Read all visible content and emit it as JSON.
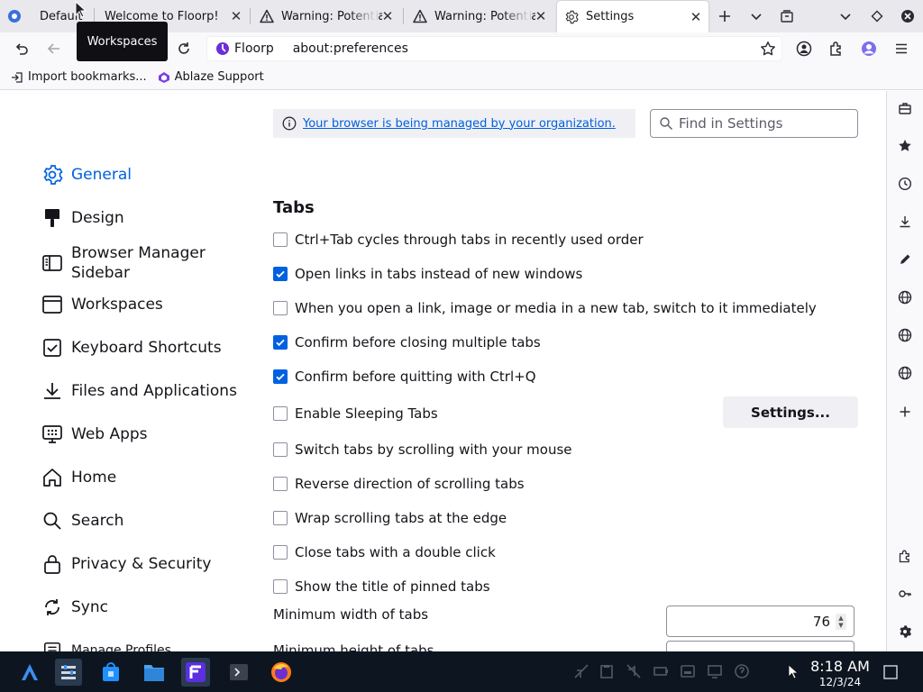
{
  "tabs": [
    {
      "title": "Default",
      "icon": "floorp-workspace-icon"
    },
    {
      "title": "Welcome to Floorp!",
      "icon": "none"
    },
    {
      "title": "Warning: Potential Security Risk",
      "icon": "warning-icon"
    },
    {
      "title": "Warning: Potential Security Risk",
      "icon": "warning-icon"
    },
    {
      "title": "Settings",
      "icon": "gear-icon",
      "selected": true
    }
  ],
  "tooltip": "Workspaces",
  "urlbar": {
    "brand": "Floorp",
    "url": "about:preferences"
  },
  "bookmarks": [
    {
      "label": "Import bookmarks...",
      "icon": "import-icon"
    },
    {
      "label": "Ablaze Support",
      "icon": "ablaze-icon"
    }
  ],
  "categories": [
    {
      "label": "General",
      "icon": "gear-icon",
      "active": true
    },
    {
      "label": "Design",
      "icon": "paintbrush-icon"
    },
    {
      "label": "Browser Manager Sidebar",
      "icon": "sidebar-icon"
    },
    {
      "label": "Workspaces",
      "icon": "window-icon"
    },
    {
      "label": "Keyboard Shortcuts",
      "icon": "checkbox-square-icon"
    },
    {
      "label": "Files and Applications",
      "icon": "download-icon"
    },
    {
      "label": "Web Apps",
      "icon": "grid-apps-icon"
    },
    {
      "label": "Home",
      "icon": "home-icon"
    },
    {
      "label": "Search",
      "icon": "search-icon"
    },
    {
      "label": "Privacy & Security",
      "icon": "lock-icon"
    },
    {
      "label": "Sync",
      "icon": "sync-icon"
    },
    {
      "label": "Manage Profiles",
      "icon": "profiles-icon"
    }
  ],
  "policy_notice": "Your browser is being managed by your organization.",
  "find_placeholder": "Find in Settings",
  "section_title": "Tabs",
  "options": [
    {
      "label": "Ctrl+Tab cycles through tabs in recently used order",
      "checked": false
    },
    {
      "label": "Open links in tabs instead of new windows",
      "checked": true
    },
    {
      "label": "When you open a link, image or media in a new tab, switch to it immediately",
      "checked": false
    },
    {
      "label": "Confirm before closing multiple tabs",
      "checked": true
    },
    {
      "label": "Confirm before quitting with Ctrl+Q",
      "checked": true
    },
    {
      "label": "Enable Sleeping Tabs",
      "checked": false
    },
    {
      "label": "Switch tabs by scrolling with your mouse",
      "checked": false
    },
    {
      "label": "Reverse direction of scrolling tabs",
      "checked": false
    },
    {
      "label": "Wrap scrolling tabs at the edge",
      "checked": false
    },
    {
      "label": "Close tabs with a double click",
      "checked": false
    },
    {
      "label": "Show the title of pinned tabs",
      "checked": false
    }
  ],
  "sleeping_settings_button": "Settings...",
  "min_width_label": "Minimum width of tabs",
  "min_width_value": "76",
  "min_height_label": "Minimum height of tabs",
  "clock": {
    "time": "8:18 AM",
    "date": "12/3/24"
  },
  "colors": {
    "accent": "#0061e0",
    "taskbar": "#0d1620",
    "tabstrip": "#e8e8ed"
  }
}
